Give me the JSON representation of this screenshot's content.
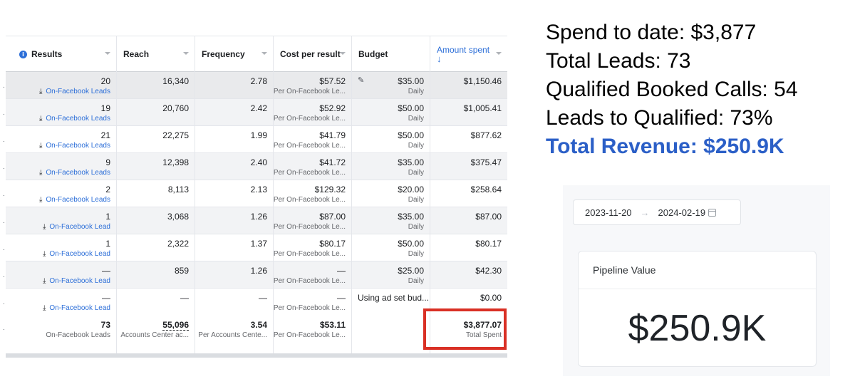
{
  "table": {
    "headers": {
      "results": "Results",
      "reach": "Reach",
      "frequency": "Frequency",
      "cost_per_result": "Cost per result",
      "budget": "Budget",
      "amount_spent": "Amount spent",
      "amount_spent_sort": "↓"
    },
    "rows": [
      {
        "results": "20",
        "results_sub": "On-Facebook Leads",
        "reach": "16,340",
        "frequency": "2.78",
        "cost": "$57.52",
        "cost_sub": "Per On-Facebook Le...",
        "budget": "$35.00",
        "budget_sub": "Daily",
        "spent": "$1,150.46"
      },
      {
        "results": "19",
        "results_sub": "On-Facebook Leads",
        "reach": "20,760",
        "frequency": "2.42",
        "cost": "$52.92",
        "cost_sub": "Per On-Facebook Le...",
        "budget": "$50.00",
        "budget_sub": "Daily",
        "spent": "$1,005.41"
      },
      {
        "results": "21",
        "results_sub": "On-Facebook Leads",
        "reach": "22,275",
        "frequency": "1.99",
        "cost": "$41.79",
        "cost_sub": "Per On-Facebook Le...",
        "budget": "$50.00",
        "budget_sub": "Daily",
        "spent": "$877.62"
      },
      {
        "results": "9",
        "results_sub": "On-Facebook Leads",
        "reach": "12,398",
        "frequency": "2.40",
        "cost": "$41.72",
        "cost_sub": "Per On-Facebook Le...",
        "budget": "$35.00",
        "budget_sub": "Daily",
        "spent": "$375.47"
      },
      {
        "results": "2",
        "results_sub": "On-Facebook Leads",
        "reach": "8,113",
        "frequency": "2.13",
        "cost": "$129.32",
        "cost_sub": "Per On-Facebook Le...",
        "budget": "$20.00",
        "budget_sub": "Daily",
        "spent": "$258.64"
      },
      {
        "results": "1",
        "results_sub": "On-Facebook Lead",
        "reach": "3,068",
        "frequency": "1.26",
        "cost": "$87.00",
        "cost_sub": "Per On-Facebook Le...",
        "budget": "$35.00",
        "budget_sub": "Daily",
        "spent": "$87.00"
      },
      {
        "results": "1",
        "results_sub": "On-Facebook Lead",
        "reach": "2,322",
        "frequency": "1.37",
        "cost": "$80.17",
        "cost_sub": "Per On-Facebook Le...",
        "budget": "$50.00",
        "budget_sub": "Daily",
        "spent": "$80.17"
      },
      {
        "results": "—",
        "results_sub": "On-Facebook Lead",
        "reach": "859",
        "frequency": "1.26",
        "cost": "—",
        "cost_sub": "Per On-Facebook Le...",
        "budget": "$25.00",
        "budget_sub": "Daily",
        "spent": "$42.30"
      },
      {
        "results": "—",
        "results_sub": "On-Facebook Lead",
        "reach": "—",
        "frequency": "—",
        "cost": "—",
        "cost_sub": "Per On-Facebook Le...",
        "budget_text": "Using ad set bud...",
        "spent": "$0.00"
      }
    ],
    "totals": {
      "results": "73",
      "results_sub": "On-Facebook Leads",
      "reach": "55,096",
      "reach_sub": "Accounts Center ac...",
      "frequency": "3.54",
      "frequency_sub": "Per Accounts Cente...",
      "cost": "$53.11",
      "cost_sub": "Per On-Facebook Le...",
      "spent": "$3,877.07",
      "spent_sub": "Total Spent"
    }
  },
  "stats": {
    "spend": "Spend to date: $3,877",
    "leads": "Total Leads: 73",
    "booked": "Qualified Booked Calls: 54",
    "ratio": "Leads to Qualified: 73%",
    "revenue": "Total Revenue: $250.9K"
  },
  "pipeline": {
    "date_start": "2023-11-20",
    "date_end": "2024-02-19",
    "title": "Pipeline Value",
    "value": "$250.9K"
  },
  "colors": {
    "accent": "#2d6fd8",
    "revenue": "#2b5fc7",
    "highlight": "#d93025"
  }
}
